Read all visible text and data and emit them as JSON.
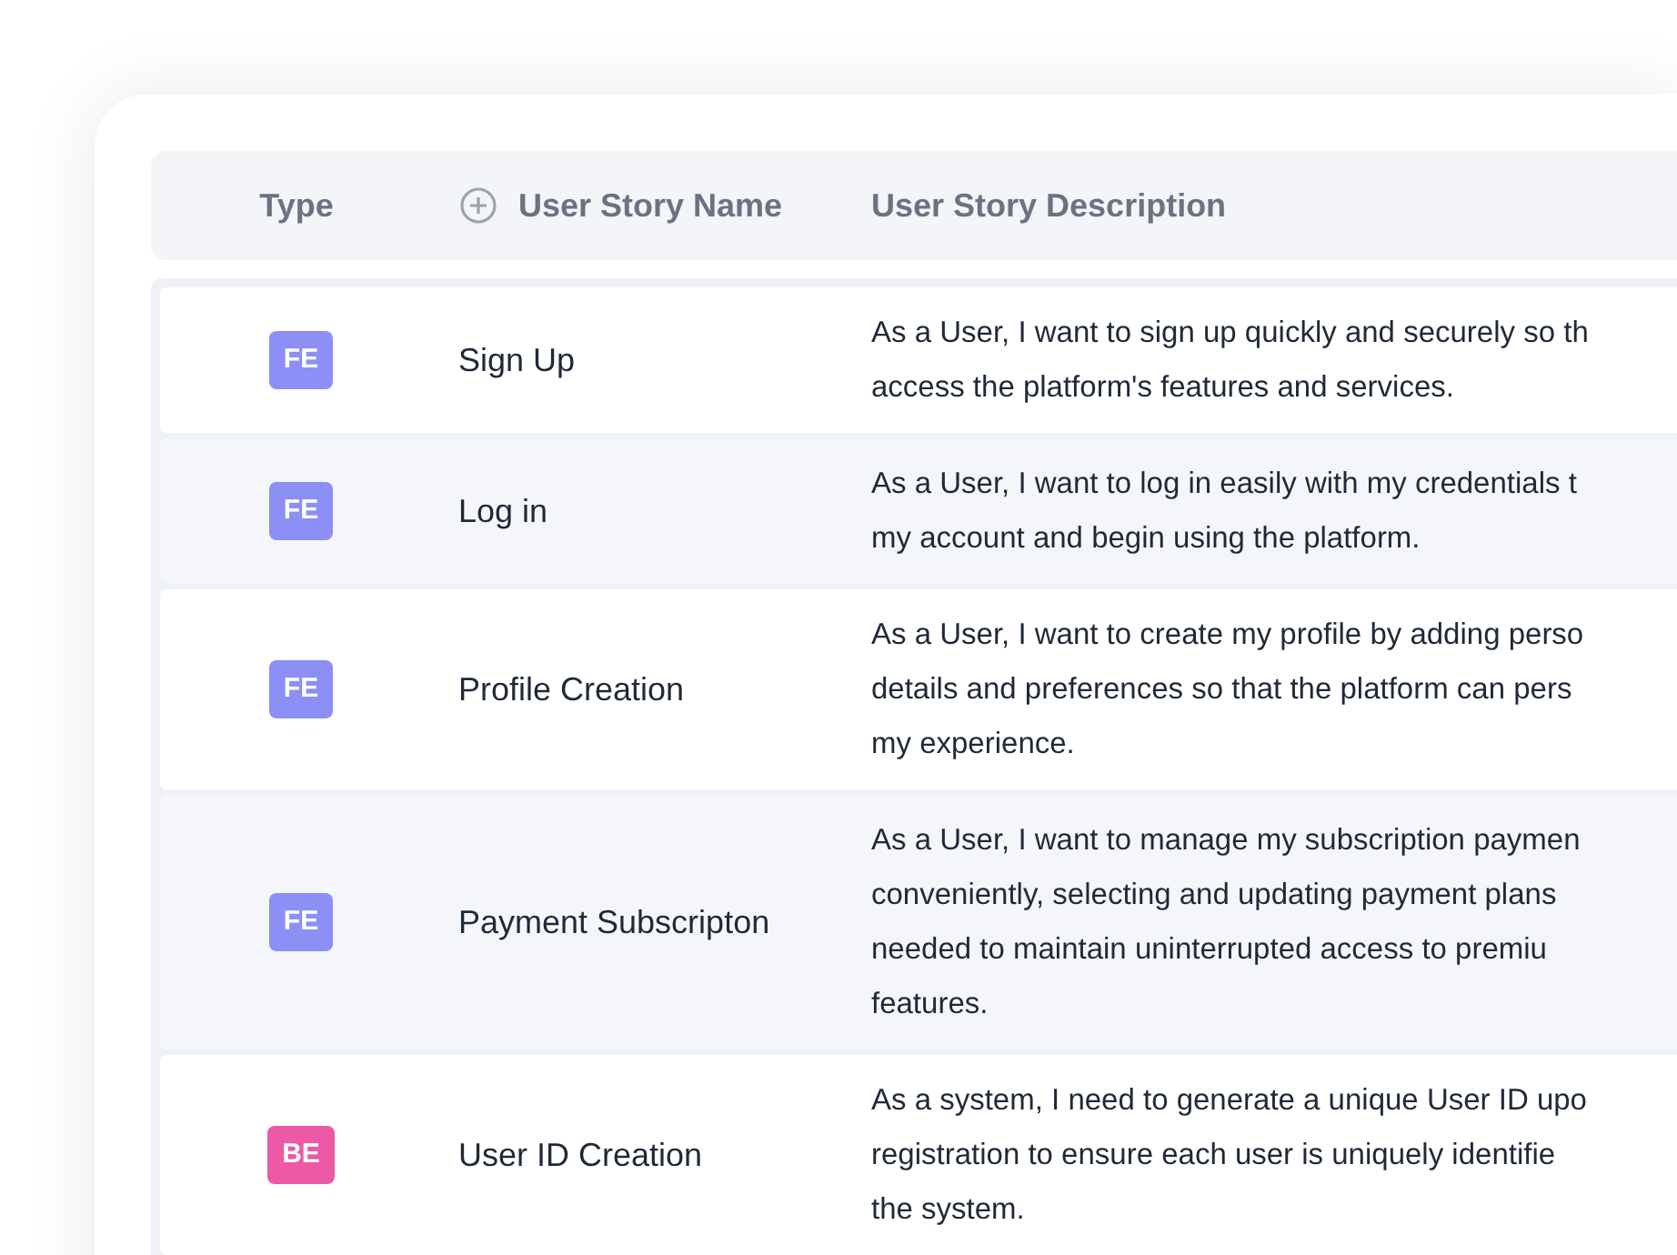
{
  "table": {
    "columns": [
      {
        "label": "Type"
      },
      {
        "label": "User Story Name",
        "icon": true
      },
      {
        "label": "User Story Description"
      }
    ],
    "rows": [
      {
        "type": "FE",
        "color": "#8b8ff6",
        "name": "Sign Up",
        "description": [
          "As a User, I want to sign up quickly and securely so th",
          "access the platform's features and services."
        ]
      },
      {
        "type": "FE",
        "color": "#8b8ff6",
        "name": "Log in",
        "description": [
          "As a User, I want to log in easily with my credentials t",
          "my account and begin using the platform."
        ]
      },
      {
        "type": "FE",
        "color": "#8b8ff6",
        "name": "Profile Creation",
        "description": [
          "As a User, I want to create my profile by adding perso",
          "details and preferences so that the platform can pers",
          "my experience."
        ]
      },
      {
        "type": "FE",
        "color": "#8b8ff6",
        "name": "Payment Subscripton",
        "description": [
          "As a User, I want to manage my subscription paymen",
          "conveniently, selecting and updating payment plans",
          "needed to maintain uninterrupted access to premiu",
          "features."
        ]
      },
      {
        "type": "BE",
        "color": "#ec5aa5",
        "name": "User ID Creation",
        "description": [
          "As a system, I need to generate a unique User ID upo",
          "registration to ensure each user is uniquely identifie",
          "the system."
        ]
      }
    ]
  }
}
